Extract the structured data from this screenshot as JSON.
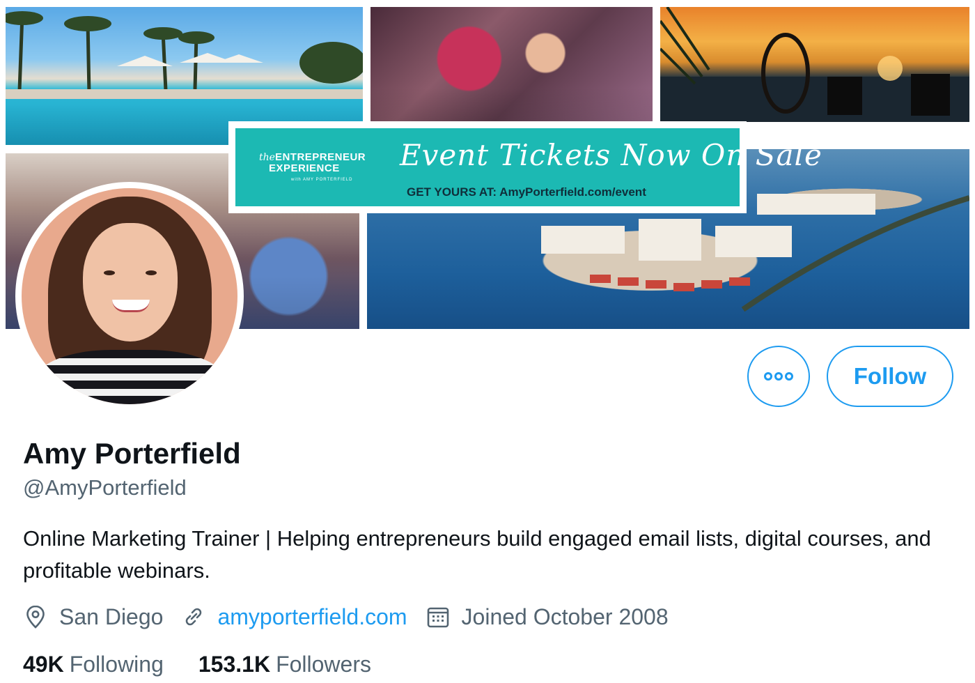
{
  "banner": {
    "promo": {
      "brand_the": "the",
      "brand_line1": "ENTREPRENEUR",
      "brand_line2": "EXPERIENCE",
      "brand_line3": "with AMY PORTERFIELD",
      "headline": "Event Tickets Now On Sale",
      "cta": "GET YOURS AT: AmyPorterfield.com/event"
    },
    "accent_color": "#1cb9b3"
  },
  "actions": {
    "more_icon": "more-dots-icon",
    "follow_label": "Follow",
    "accent_color": "#1d9bf0"
  },
  "profile": {
    "name": "Amy Porterfield",
    "handle": "@AmyPorterfield",
    "bio": "Online Marketing Trainer | Helping entrepreneurs build engaged email lists, digital courses, and profitable webinars.",
    "location": "San Diego",
    "location_icon": "location-pin-icon",
    "website": "amyporterfield.com",
    "website_icon": "link-icon",
    "joined": "Joined October 2008",
    "joined_icon": "calendar-icon"
  },
  "stats": {
    "following_count": "49K",
    "following_label": "Following",
    "followers_count": "153.1K",
    "followers_label": "Followers"
  }
}
